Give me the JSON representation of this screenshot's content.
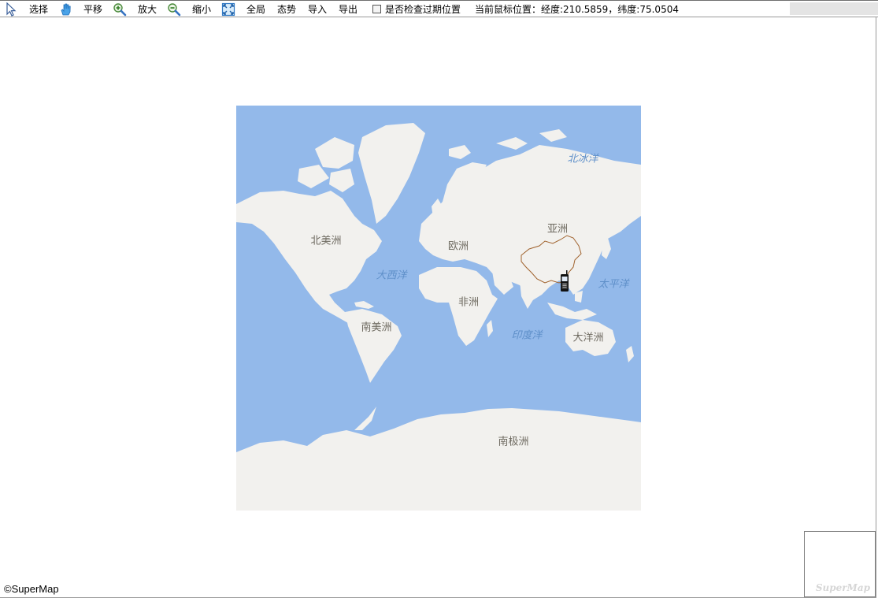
{
  "toolbar": {
    "tools": [
      {
        "id": "select",
        "label": "选择",
        "icon": "arrow-cursor-icon"
      },
      {
        "id": "pan",
        "label": "平移",
        "icon": "hand-icon"
      },
      {
        "id": "zoom-in",
        "label": "放大",
        "icon": "zoom-in-icon"
      },
      {
        "id": "zoom-out",
        "label": "缩小",
        "icon": "zoom-out-icon"
      },
      {
        "id": "full-extent",
        "label": "全局",
        "icon": "full-extent-icon"
      }
    ],
    "menu": [
      "态势",
      "导入",
      "导出"
    ],
    "expired_check": {
      "label": "是否检查过期位置",
      "checked": false
    },
    "mouse_position": "当前鼠标位置：经度:210.5859，纬度:75.0504"
  },
  "map": {
    "continent_labels": [
      "北美洲",
      "欧洲",
      "亚洲",
      "非洲",
      "南美洲",
      "大洋洲",
      "南极洲"
    ],
    "ocean_labels": [
      "北冰洋",
      "大西洋",
      "太平洋",
      "印度洋"
    ],
    "colors": {
      "ocean": "#93b9ea",
      "land": "#f2f1ee",
      "china_border": "#a0622d",
      "label": "#6e6a60",
      "ocean_label": "#5e8fc9"
    },
    "marker": {
      "type": "mobile-phone-icon"
    },
    "copyright": "©SuperMap",
    "overview_logo": "SuperMap"
  }
}
